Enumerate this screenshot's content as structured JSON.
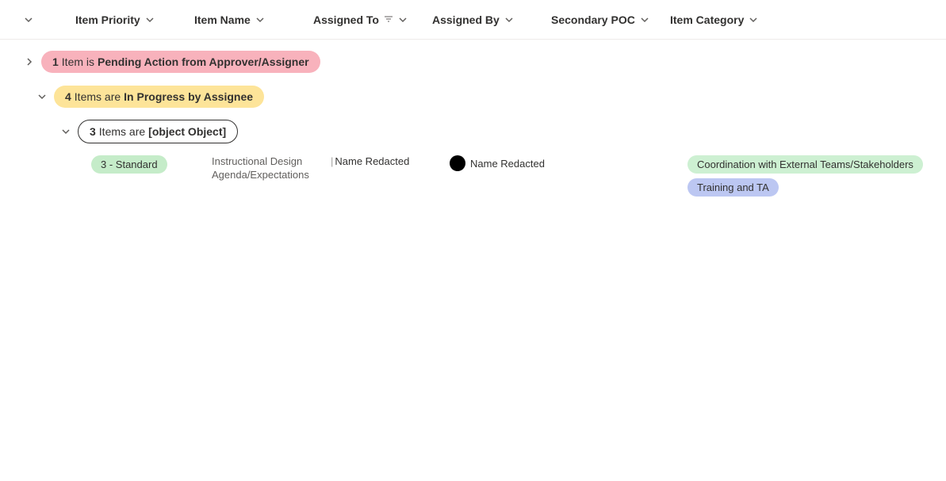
{
  "columns": {
    "priority": "Item Priority",
    "name": "Item Name",
    "assigned_to": "Assigned To",
    "assigned_by": "Assigned By",
    "secondary_poc": "Secondary POC",
    "category": "Item Category"
  },
  "groups": {
    "pending": {
      "count": "1",
      "label": "Item is",
      "status": "Pending Action from Approver/Assigner"
    },
    "in_progress": {
      "count": "4",
      "label": "Items are",
      "status": "In Progress by Assignee"
    },
    "subgroup": {
      "count": "3",
      "label": "Items are",
      "status": "[object Object]"
    }
  },
  "row": {
    "priority": "3 - Standard",
    "name": "Instructional Design Agenda/Expectations",
    "assigned_to": "Name Redacted",
    "assigned_by": "Name Redacted",
    "secondary_poc": "",
    "categories": {
      "cat1": "Coordination with External Teams/Stakeholders",
      "cat2": "Training and TA"
    }
  }
}
